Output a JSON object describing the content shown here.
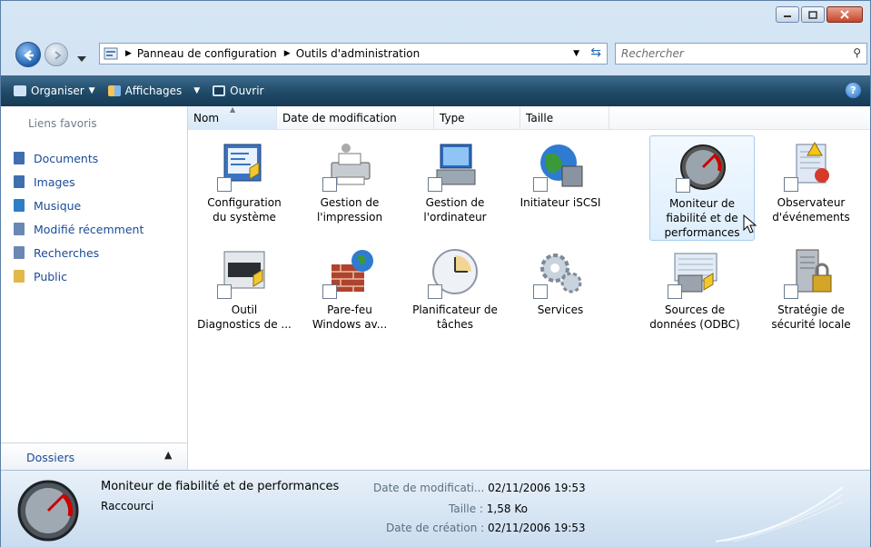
{
  "address": {
    "crumbs": [
      "Panneau de configuration",
      "Outils d'administration"
    ]
  },
  "search": {
    "placeholder": "Rechercher"
  },
  "toolbar": {
    "organize": "Organiser",
    "views": "Affichages",
    "open": "Ouvrir"
  },
  "nav": {
    "favorites_label": "Liens favoris",
    "items": [
      {
        "label": "Documents",
        "color": "#3f6fb0"
      },
      {
        "label": "Images",
        "color": "#3f6fb0"
      },
      {
        "label": "Musique",
        "color": "#2e7ec6"
      },
      {
        "label": "Modifié récemment",
        "color": "#6b87b3"
      },
      {
        "label": "Recherches",
        "color": "#6b87b3"
      },
      {
        "label": "Public",
        "color": "#e2b84a"
      }
    ],
    "folders_label": "Dossiers"
  },
  "columns": [
    "Nom",
    "Date de modification",
    "Type",
    "Taille"
  ],
  "items": [
    {
      "line1": "Configuration",
      "line2": "du système",
      "line3": ""
    },
    {
      "line1": "Gestion de",
      "line2": "l'impression",
      "line3": ""
    },
    {
      "line1": "Gestion de",
      "line2": "l'ordinateur",
      "line3": ""
    },
    {
      "line1": "Initiateur iSCSI",
      "line2": "",
      "line3": ""
    },
    {
      "line1": "Moniteur de",
      "line2": "fiabilité et de",
      "line3": "performances"
    },
    {
      "line1": "Observateur",
      "line2": "d'événements",
      "line3": ""
    },
    {
      "line1": "Outil",
      "line2": "Diagnostics de ...",
      "line3": ""
    },
    {
      "line1": "Pare-feu",
      "line2": "Windows av...",
      "line3": ""
    },
    {
      "line1": "Planificateur de",
      "line2": "tâches",
      "line3": ""
    },
    {
      "line1": "Services",
      "line2": "",
      "line3": ""
    },
    {
      "line1": "Sources de",
      "line2": "données (ODBC)",
      "line3": ""
    },
    {
      "line1": "Stratégie de",
      "line2": "sécurité locale",
      "line3": ""
    }
  ],
  "status": {
    "name": "Moniteur de fiabilité et de performances",
    "kind": "Raccourci",
    "modified_label": "Date de modificati...",
    "modified_value": "02/11/2006 19:53",
    "size_label": "Taille :",
    "size_value": "1,58 Ko",
    "created_label": "Date de création :",
    "created_value": "02/11/2006 19:53"
  }
}
